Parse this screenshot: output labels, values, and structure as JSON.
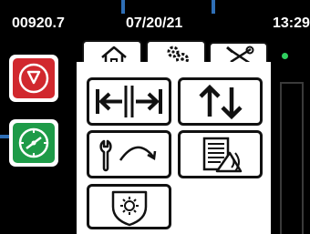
{
  "status_bar": {
    "odometer": "00920.7",
    "date": "07/20/21",
    "time": "13:29"
  },
  "side_buttons": [
    {
      "name": "emergency-stop",
      "icon": "stop-octagon-icon",
      "color": "#d1282e"
    },
    {
      "name": "start",
      "icon": "compass-start-icon",
      "color": "#1e9b48"
    }
  ],
  "tabs": [
    {
      "name": "home",
      "icon": "home-icon",
      "active": false
    },
    {
      "name": "settings",
      "icon": "gears-icon",
      "active": false
    },
    {
      "name": "tools",
      "icon": "tools-icon",
      "active": true
    }
  ],
  "tool_tiles": [
    {
      "name": "width-adjust",
      "icon": "horizontal-arrows-icon"
    },
    {
      "name": "height-adjust",
      "icon": "up-down-arrows-icon"
    },
    {
      "name": "wrench-rotate",
      "icon": "wrench-rotate-icon"
    },
    {
      "name": "list-signal",
      "icon": "list-signal-icon"
    },
    {
      "name": "sun-shield",
      "icon": "sun-shield-icon"
    }
  ],
  "colors": {
    "background": "#000000",
    "stop_red": "#d1282e",
    "go_green": "#1e9b48",
    "callout_blue": "#2f6fb6",
    "indicator_green": "#2fd05f"
  }
}
